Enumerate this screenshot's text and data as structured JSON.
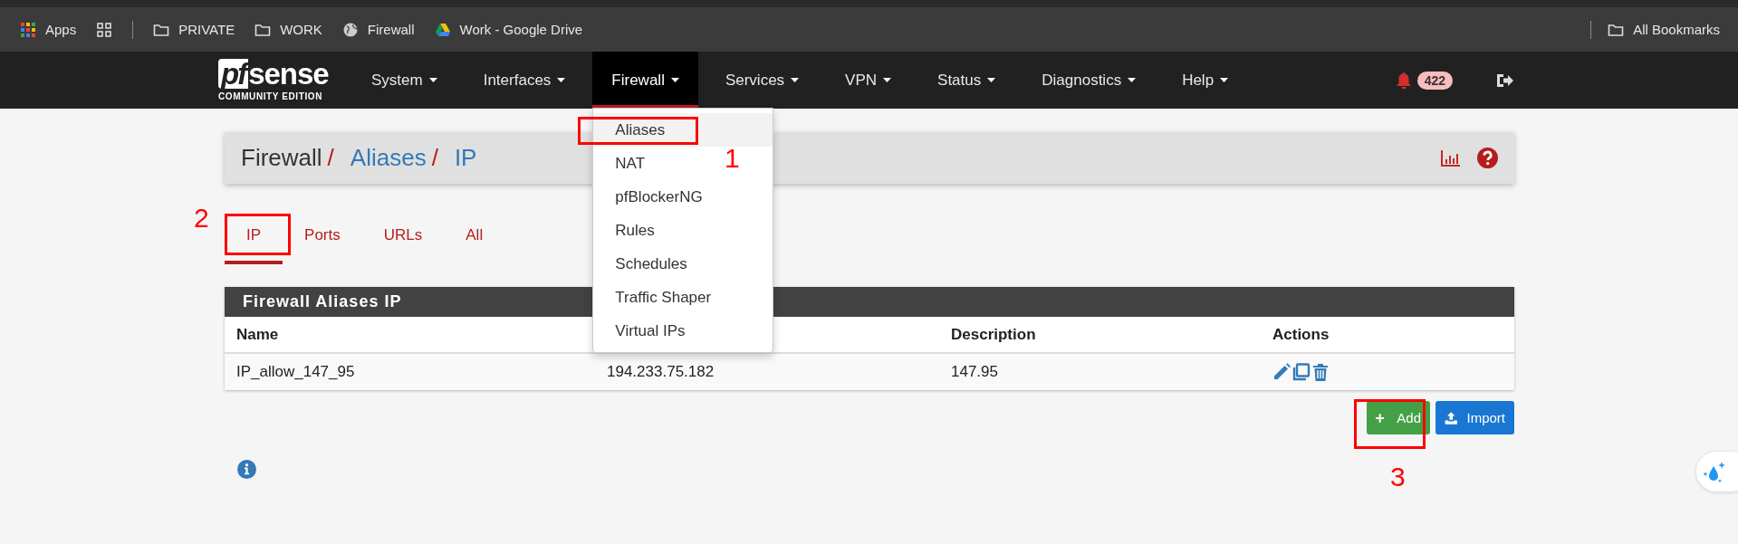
{
  "bookmarks_bar": {
    "items": [
      {
        "kind": "apps",
        "label": "Apps"
      },
      {
        "kind": "grid"
      },
      {
        "kind": "separator"
      },
      {
        "kind": "folder",
        "label": "PRIVATE"
      },
      {
        "kind": "folder",
        "label": "WORK"
      },
      {
        "kind": "globe",
        "label": "Firewall"
      },
      {
        "kind": "drive",
        "label": "Work - Google Drive"
      }
    ],
    "all_bookmarks": {
      "label": "All Bookmarks"
    }
  },
  "navbar": {
    "logo": {
      "mark": "pf",
      "word": "sense",
      "tagline": "COMMUNITY EDITION"
    },
    "menu": [
      {
        "label": "System",
        "selected": false
      },
      {
        "label": "Interfaces",
        "selected": false
      },
      {
        "label": "Firewall",
        "selected": true
      },
      {
        "label": "Services",
        "selected": false
      },
      {
        "label": "VPN",
        "selected": false
      },
      {
        "label": "Status",
        "selected": false
      },
      {
        "label": "Diagnostics",
        "selected": false
      },
      {
        "label": "Help",
        "selected": false
      }
    ],
    "notifications": {
      "count": "422"
    }
  },
  "dropdown": {
    "items": [
      {
        "label": "Aliases",
        "selected": true
      },
      {
        "label": "NAT",
        "selected": false
      },
      {
        "label": "pfBlockerNG",
        "selected": false
      },
      {
        "label": "Rules",
        "selected": false
      },
      {
        "label": "Schedules",
        "selected": false
      },
      {
        "label": "Traffic Shaper",
        "selected": false
      },
      {
        "label": "Virtual IPs",
        "selected": false
      }
    ]
  },
  "breadcrumb": [
    {
      "label": "Firewall",
      "link": false,
      "separator": "/"
    },
    {
      "label": "Aliases",
      "link": true,
      "separator": "/"
    },
    {
      "label": "IP",
      "link": true
    }
  ],
  "tabs": [
    {
      "label": "IP",
      "selected": true
    },
    {
      "label": "Ports",
      "selected": false
    },
    {
      "label": "URLs",
      "selected": false
    },
    {
      "label": "All",
      "selected": false
    }
  ],
  "table": {
    "title": "Firewall Aliases IP",
    "columns": [
      {
        "kind": "header",
        "label": "Name"
      },
      {
        "kind": "covered"
      },
      {
        "kind": "header",
        "label": "Description"
      },
      {
        "kind": "header",
        "label": "Actions"
      }
    ],
    "rows": [
      {
        "cells": [
          "IP_allow_147_95",
          "194.233.75.182",
          "147.95"
        ],
        "actions": [
          {
            "kind": "edit"
          },
          {
            "kind": "copy"
          },
          {
            "kind": "delete"
          }
        ]
      }
    ]
  },
  "buttons": [
    {
      "kind": "add",
      "label": "Add"
    },
    {
      "kind": "import",
      "label": "Import"
    }
  ],
  "annotations": [
    {
      "label": "1"
    },
    {
      "label": "2"
    },
    {
      "label": "3"
    }
  ]
}
